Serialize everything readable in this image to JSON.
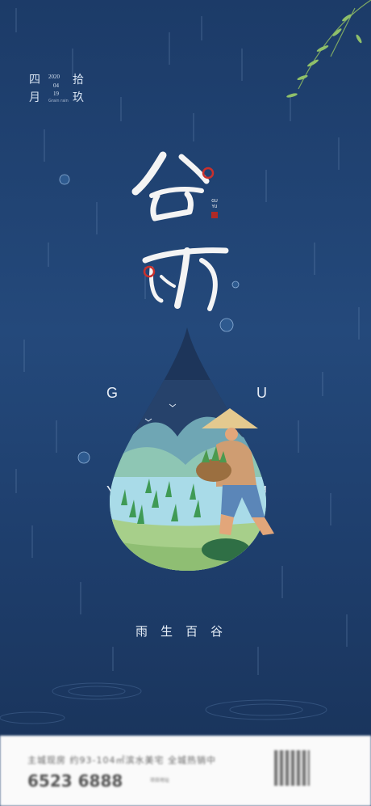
{
  "poster": {
    "date": {
      "month_cn": "四",
      "month_char": "月",
      "day_cn_1": "拾",
      "day_cn_2": "玖",
      "year": "2020",
      "month_num": "04",
      "day_num": "19",
      "sub": "Grain rain"
    },
    "title_glyphs": [
      "谷",
      "雨"
    ],
    "seal_text": "GU YU",
    "letters": [
      "G",
      "U",
      "Y",
      "U"
    ],
    "slogan": "雨生百谷",
    "colors": {
      "background": "#1f3f6e",
      "drop_sky": "#26426b",
      "field": "#a9dbe8",
      "accent_red": "#c9302c"
    }
  },
  "footer": {
    "line1": "主城现房 约93-104㎡滨水美宅 全城热销中",
    "phone": "6523 6888",
    "small": "项目地址"
  }
}
